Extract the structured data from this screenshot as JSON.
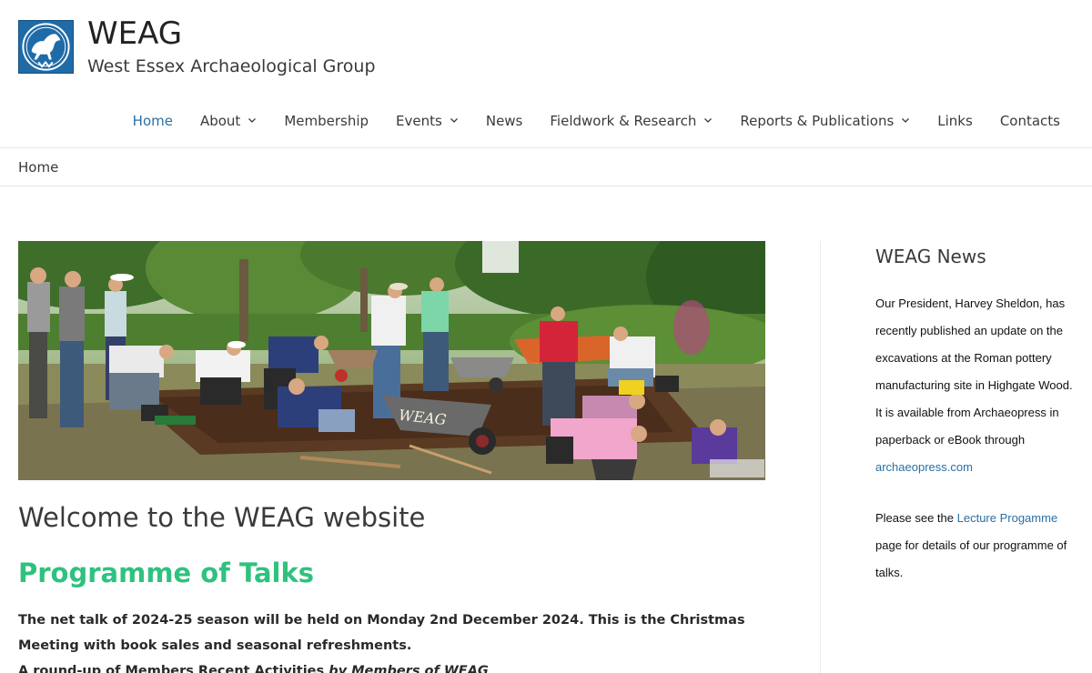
{
  "site": {
    "title": "WEAG",
    "tagline": "West Essex Archaeological Group"
  },
  "nav": {
    "items": [
      {
        "label": "Home",
        "active": true,
        "has_dropdown": false
      },
      {
        "label": "About",
        "active": false,
        "has_dropdown": true
      },
      {
        "label": "Membership",
        "active": false,
        "has_dropdown": false
      },
      {
        "label": "Events",
        "active": false,
        "has_dropdown": true
      },
      {
        "label": "News",
        "active": false,
        "has_dropdown": false
      },
      {
        "label": "Fieldwork & Research",
        "active": false,
        "has_dropdown": true
      },
      {
        "label": "Reports & Publications",
        "active": false,
        "has_dropdown": true
      },
      {
        "label": "Links",
        "active": false,
        "has_dropdown": false
      },
      {
        "label": "Contacts",
        "active": false,
        "has_dropdown": false
      }
    ]
  },
  "breadcrumb": "Home",
  "main": {
    "hero_wheelbarrow_text": "WEAG",
    "welcome_title": "Welcome to the WEAG website",
    "talks_heading": "Programme of Talks",
    "talk_text": "The net talk of 2024-25 season will be held on Monday 2nd December 2024. This is the Christmas Meeting with book sales and seasonal refreshments.",
    "talk_line3_a": "A round-up of Members Recent Activities ",
    "talk_line3_b": "by Members of WEAG"
  },
  "sidebar": {
    "title": "WEAG News",
    "para1_text": "Our President, Harvey Sheldon, has recently published an update on the excavations at the Roman pottery manufacturing site in Highgate Wood. It is available from Archaeopress in paperback or eBook through ",
    "para1_link": "archaeopress.com",
    "para2_before": "Please see the ",
    "para2_link": "Lecture Progamme",
    "para2_after": " page for details of our programme of talks."
  },
  "colors": {
    "accent_link": "#2a6fa3",
    "heading_green": "#2ec27e",
    "logo_blue": "#1f6ba8"
  }
}
